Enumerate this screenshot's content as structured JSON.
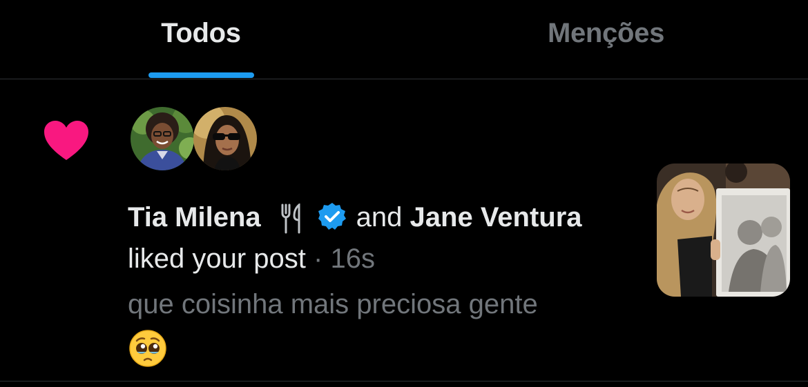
{
  "tabs": {
    "todos_label": "Todos",
    "mencoes_label": "Menções",
    "active": "Todos"
  },
  "notification": {
    "type_icon": "heart-icon",
    "user1_name": "Tia Milena",
    "user1_decoration_icon": "fork-and-knife-icon",
    "user1_verified_icon": "verified-badge-icon",
    "connector": "and",
    "user2_name": "Jane Ventura",
    "action": "liked your post",
    "separator": "·",
    "time": "16s",
    "post_text": "que coisinha mais preciosa gente",
    "post_emoji": "🥹"
  },
  "colors": {
    "background": "#000000",
    "primary_text": "#e7e9ea",
    "secondary_text": "#71767b",
    "accent": "#1d9bf0",
    "heart": "#f91880",
    "divider": "#2f3336"
  }
}
